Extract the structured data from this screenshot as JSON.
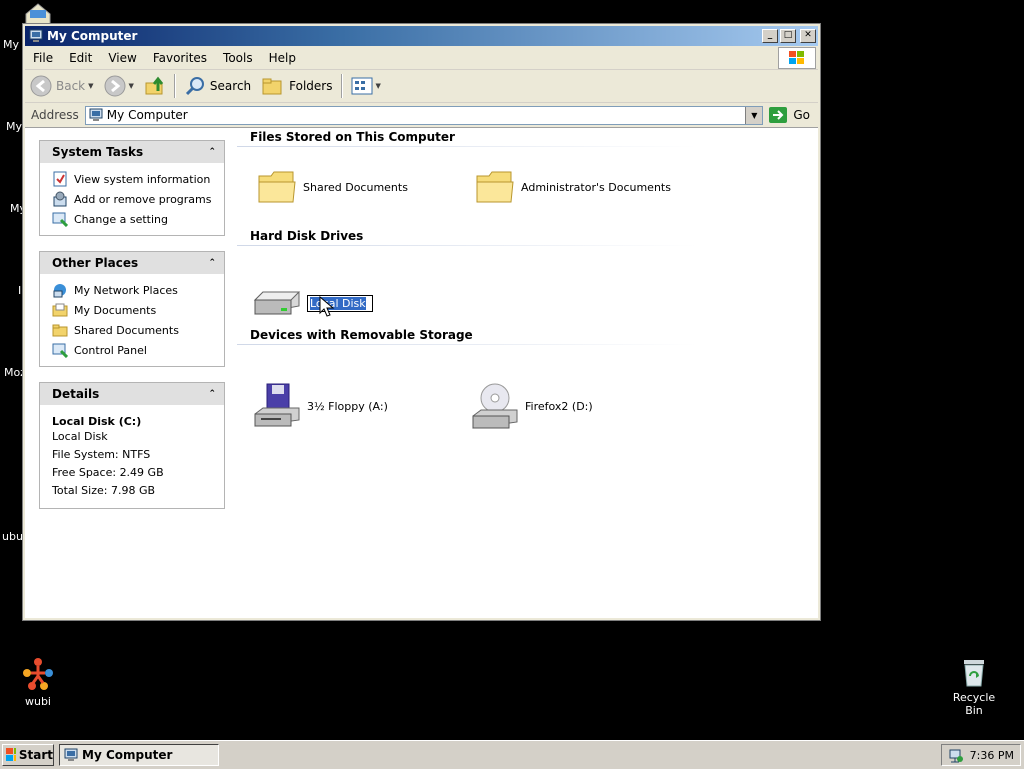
{
  "desktop": {
    "partial_labels": [
      "My I",
      "My",
      "My",
      "I\nE",
      "Moz",
      "ubun"
    ],
    "icons": [
      {
        "label": "wubi",
        "icon": "wubi-icon"
      },
      {
        "label": "Recycle Bin",
        "icon": "recycle-bin-icon"
      }
    ]
  },
  "window": {
    "title": "My Computer",
    "menu": [
      "File",
      "Edit",
      "View",
      "Favorites",
      "Tools",
      "Help"
    ],
    "toolbar": {
      "back": "Back",
      "search": "Search",
      "folders": "Folders"
    },
    "address": {
      "label": "Address",
      "value": "My Computer",
      "go": "Go"
    }
  },
  "task_pane": {
    "system_tasks": {
      "title": "System Tasks",
      "links": [
        "View system information",
        "Add or remove programs",
        "Change a setting"
      ]
    },
    "other_places": {
      "title": "Other Places",
      "links": [
        "My Network Places",
        "My Documents",
        "Shared Documents",
        "Control Panel"
      ]
    },
    "details": {
      "title": "Details",
      "name": "Local Disk (C:)",
      "type": "Local Disk",
      "filesystem": "File System: NTFS",
      "free": "Free Space: 2.49 GB",
      "total": "Total Size: 7.98 GB"
    }
  },
  "main": {
    "files_group": {
      "title": "Files Stored on This Computer",
      "items": [
        "Shared Documents",
        "Administrator's Documents"
      ]
    },
    "hdd_group": {
      "title": "Hard Disk Drives",
      "rename_value": "Local Disk"
    },
    "removable_group": {
      "title": "Devices with Removable Storage",
      "items": [
        "3½ Floppy (A:)",
        "Firefox2 (D:)"
      ]
    }
  },
  "taskbar": {
    "start": "Start",
    "task": "My Computer",
    "clock": "7:36 PM"
  },
  "colors": {
    "titlebar_start": "#0a246a",
    "titlebar_end": "#a6caf0",
    "selection": "#316ac5",
    "panel_header": "#e0e0e0"
  }
}
